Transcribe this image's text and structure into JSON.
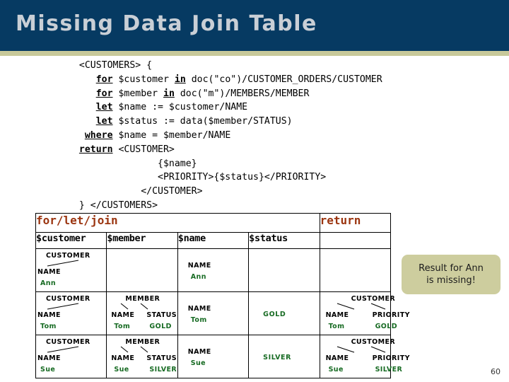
{
  "slide": {
    "title": "Missing Data Join Table",
    "page_number": "60",
    "banner_color": "#063a62",
    "rule_color": "#c8c99a",
    "title_color": "#c9cfd6"
  },
  "code": {
    "lines": [
      [
        {
          "t": "  <CUSTOMERS> {",
          "kw": false
        }
      ],
      [
        {
          "t": "     ",
          "kw": false
        },
        {
          "t": "for",
          "kw": true
        },
        {
          "t": " $customer ",
          "kw": false
        },
        {
          "t": "in",
          "kw": true
        },
        {
          "t": " doc(\"co\")/CUSTOMER_ORDERS/CUSTOMER",
          "kw": false
        }
      ],
      [
        {
          "t": "     ",
          "kw": false
        },
        {
          "t": "for",
          "kw": true
        },
        {
          "t": " $member ",
          "kw": false
        },
        {
          "t": "in",
          "kw": true
        },
        {
          "t": " doc(\"m\")/MEMBERS/MEMBER",
          "kw": false
        }
      ],
      [
        {
          "t": "     ",
          "kw": false
        },
        {
          "t": "let",
          "kw": true
        },
        {
          "t": " $name := $customer/NAME",
          "kw": false
        }
      ],
      [
        {
          "t": "     ",
          "kw": false
        },
        {
          "t": "let",
          "kw": true
        },
        {
          "t": " $status := data($member/STATUS)",
          "kw": false
        }
      ],
      [
        {
          "t": "   ",
          "kw": false
        },
        {
          "t": "where",
          "kw": true
        },
        {
          "t": " $name = $member/NAME",
          "kw": false
        }
      ],
      [
        {
          "t": "  ",
          "kw": false
        },
        {
          "t": "return",
          "kw": true
        },
        {
          "t": " <CUSTOMER>",
          "kw": false
        }
      ],
      [
        {
          "t": "                {$name}",
          "kw": false
        }
      ],
      [
        {
          "t": "                <PRIORITY>{$status}</PRIORITY>",
          "kw": false
        }
      ],
      [
        {
          "t": "             </CUSTOMER>",
          "kw": false
        }
      ],
      [
        {
          "t": "  } </CUSTOMERS>",
          "kw": false
        }
      ]
    ]
  },
  "table": {
    "group_headers": {
      "left": "for/let/join",
      "right": "return"
    },
    "variable_headers": [
      "$customer",
      "$member",
      "$name",
      "$status",
      ""
    ],
    "rows": [
      {
        "customer": {
          "root": "CUSTOMER",
          "children": [
            {
              "label": "NAME",
              "value": "Ann"
            }
          ]
        },
        "member": null,
        "name": {
          "label": "NAME",
          "value": "Ann"
        },
        "status": "",
        "return": null
      },
      {
        "customer": {
          "root": "CUSTOMER",
          "children": [
            {
              "label": "NAME",
              "value": "Tom"
            }
          ]
        },
        "member": {
          "root": "MEMBER",
          "children": [
            {
              "label": "NAME",
              "value": "Tom"
            },
            {
              "label": "STATUS",
              "value": "GOLD"
            }
          ]
        },
        "name": {
          "label": "NAME",
          "value": "Tom"
        },
        "status": "GOLD",
        "return": {
          "root": "CUSTOMER",
          "children": [
            {
              "label": "NAME",
              "value": "Tom"
            },
            {
              "label": "PRIORITY",
              "value": "GOLD"
            }
          ]
        }
      },
      {
        "customer": {
          "root": "CUSTOMER",
          "children": [
            {
              "label": "NAME",
              "value": "Sue"
            }
          ]
        },
        "member": {
          "root": "MEMBER",
          "children": [
            {
              "label": "NAME",
              "value": "Sue"
            },
            {
              "label": "STATUS",
              "value": "SILVER"
            }
          ]
        },
        "name": {
          "label": "NAME",
          "value": "Sue"
        },
        "status": "SILVER",
        "return": {
          "root": "CUSTOMER",
          "children": [
            {
              "label": "NAME",
              "value": "Sue"
            },
            {
              "label": "PRIORITY",
              "value": "SILVER"
            }
          ]
        }
      }
    ]
  },
  "callout": {
    "line1": "Result for Ann",
    "line2": "is missing!",
    "bg_color": "#cdcd9e"
  },
  "colors": {
    "value_green": "#176b23",
    "header_rust": "#9b3510"
  }
}
